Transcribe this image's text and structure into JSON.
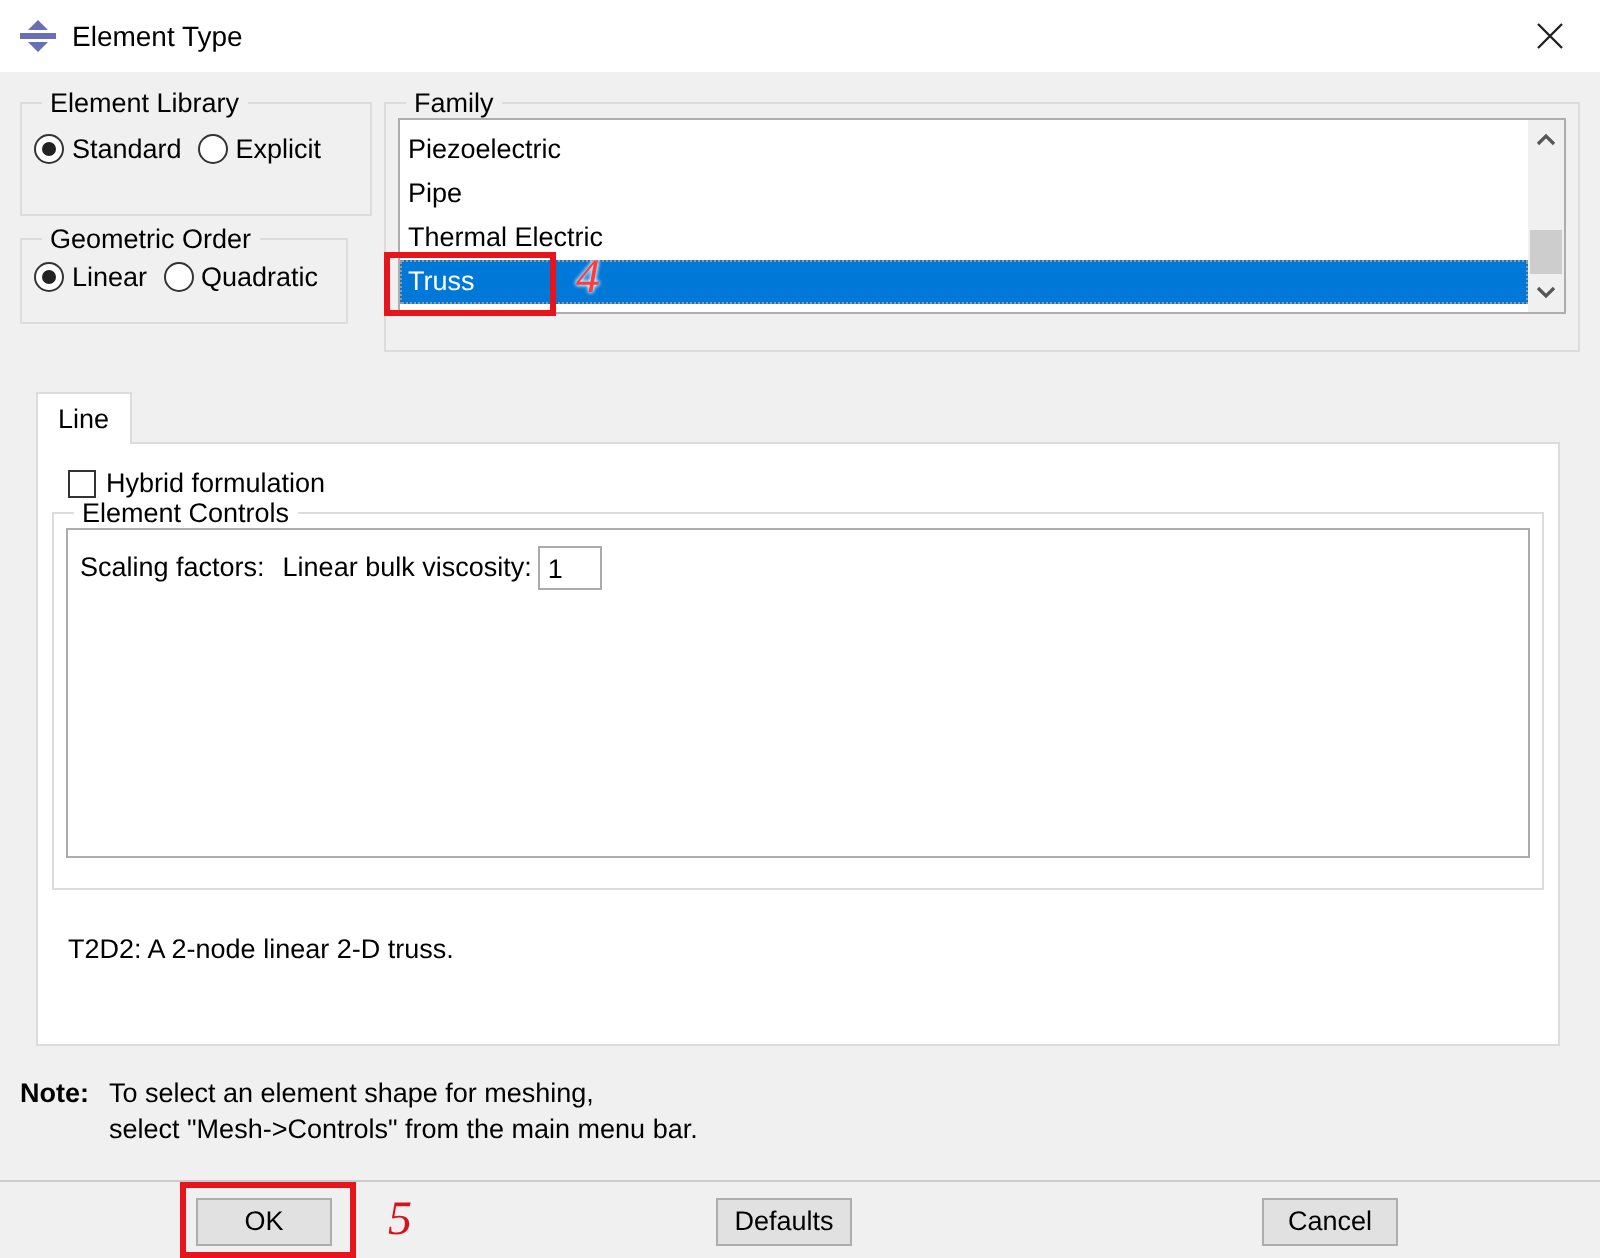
{
  "window": {
    "title": "Element Type"
  },
  "element_library": {
    "title": "Element Library",
    "options": [
      {
        "label": "Standard",
        "selected": true
      },
      {
        "label": "Explicit",
        "selected": false
      }
    ]
  },
  "geometric_order": {
    "title": "Geometric Order",
    "options": [
      {
        "label": "Linear",
        "selected": true
      },
      {
        "label": "Quadratic",
        "selected": false
      }
    ]
  },
  "family": {
    "title": "Family",
    "items": [
      {
        "label": "Piezoelectric",
        "selected": false
      },
      {
        "label": "Pipe",
        "selected": false
      },
      {
        "label": "Thermal Electric",
        "selected": false
      },
      {
        "label": "Truss",
        "selected": true
      }
    ]
  },
  "tabs": [
    {
      "label": "Line",
      "selected": true
    }
  ],
  "hybrid_formulation": {
    "label": "Hybrid formulation",
    "checked": false
  },
  "element_controls": {
    "title": "Element Controls",
    "scaling_label": "Scaling factors:",
    "viscosity_label": "Linear bulk viscosity:",
    "viscosity_value": "1"
  },
  "description": "T2D2:  A 2-node linear 2-D truss.",
  "note": {
    "label": "Note:",
    "lines": [
      "To select an element shape for meshing,",
      "select \"Mesh->Controls\" from the main menu bar."
    ]
  },
  "buttons": [
    "OK",
    "Defaults",
    "Cancel"
  ],
  "annotations": [
    {
      "label": "4"
    },
    {
      "label": "5"
    }
  ]
}
